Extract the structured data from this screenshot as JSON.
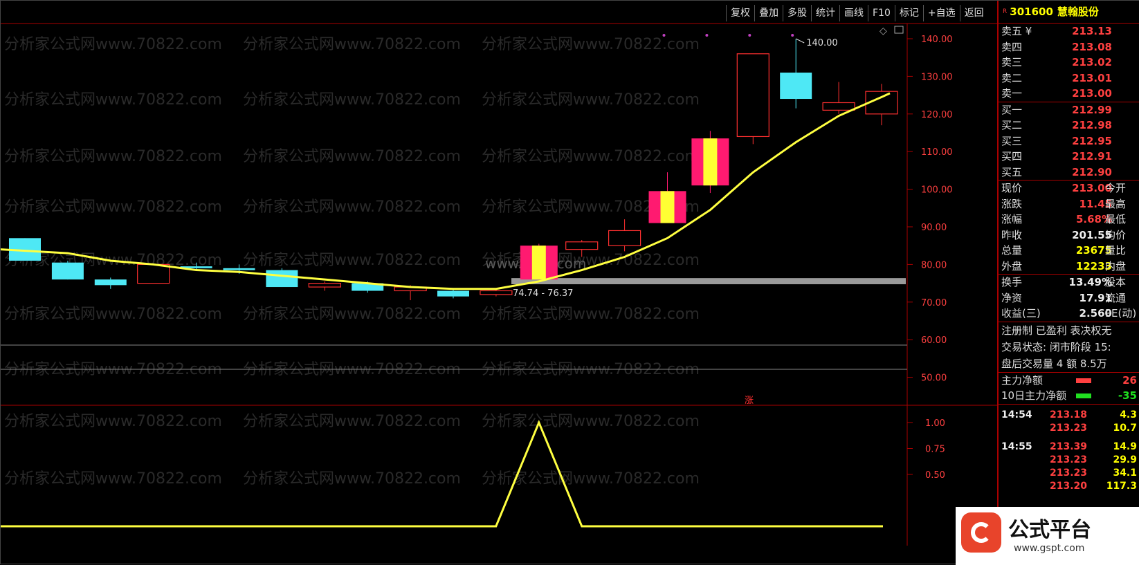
{
  "toolbar": {
    "buttons": [
      "复权",
      "叠加",
      "多股",
      "统计",
      "画线",
      "F10",
      "标记",
      "+自选",
      "返回"
    ]
  },
  "watermark": {
    "text": "分析家公式网www.70822.com",
    "center_text": "www.gspt.com"
  },
  "quote": {
    "marker": "R",
    "code": "301600",
    "name": "慧翰股份",
    "asks": [
      {
        "label": "卖五 ¥",
        "value": "213.13"
      },
      {
        "label": "卖四",
        "value": "213.08"
      },
      {
        "label": "卖三",
        "value": "213.02"
      },
      {
        "label": "卖二",
        "value": "213.01"
      },
      {
        "label": "卖一",
        "value": "213.00"
      }
    ],
    "bids": [
      {
        "label": "买一",
        "value": "212.99"
      },
      {
        "label": "买二",
        "value": "212.98"
      },
      {
        "label": "买三",
        "value": "212.95"
      },
      {
        "label": "买四",
        "value": "212.91"
      },
      {
        "label": "买五",
        "value": "212.90"
      }
    ],
    "stats": [
      {
        "label": "现价",
        "value": "213.00",
        "label2": "今开"
      },
      {
        "label": "涨跌",
        "value": "11.45",
        "label2": "最高"
      },
      {
        "label": "涨幅",
        "value": "5.68%",
        "label2": "最低"
      },
      {
        "label": "昨收",
        "value": "201.55",
        "label2": "均价"
      },
      {
        "label": "总量",
        "value": "23675",
        "label2": "量比"
      },
      {
        "label": "外盘",
        "value": "12233",
        "label2": "内盘"
      }
    ],
    "stats2": [
      {
        "label": "换手",
        "value": "13.49%",
        "label2": "股本"
      },
      {
        "label": "净资",
        "value": "17.91",
        "label2": "流通"
      },
      {
        "label": "收益(三)",
        "value": "2.560",
        "label2": "PE(动)"
      }
    ],
    "info_lines": [
      "注册制 已盈利 表决权无",
      "交易状态: 闭市阶段 15:",
      "盘后交易量 4 额 8.5万"
    ],
    "main_flow": [
      {
        "label": "主力净额",
        "value": "26"
      },
      {
        "label": "10日主力净额",
        "value": "-35"
      }
    ],
    "ticks": [
      {
        "time": "14:54",
        "price": "213.18",
        "vol": "4.3"
      },
      {
        "time": "",
        "price": "213.23",
        "vol": "10.7"
      },
      {
        "time": "14:55",
        "price": "213.39",
        "vol": "14.9"
      },
      {
        "time": "",
        "price": "213.23",
        "vol": "29.9"
      },
      {
        "time": "",
        "price": "213.23",
        "vol": "34.1"
      },
      {
        "time": "",
        "price": "213.20",
        "vol": "117.3"
      }
    ]
  },
  "logo": {
    "title": "公式平台",
    "url": "www.gspt.com"
  },
  "chart_data": [
    {
      "type": "candlestick",
      "y_ticks": [
        "140.00",
        "130.00",
        "120.00",
        "110.00",
        "100.00",
        "90.00",
        "80.00",
        "70.00",
        "60.00",
        "50.00"
      ],
      "ylim": [
        45,
        145
      ],
      "candles": [
        {
          "o": 81,
          "c": 87,
          "h": 87,
          "l": 81,
          "style": "cyan"
        },
        {
          "o": 80.5,
          "c": 76,
          "h": 81,
          "l": 76,
          "style": "cyan"
        },
        {
          "o": 76,
          "c": 74.5,
          "h": 76.5,
          "l": 73.5,
          "style": "cyan"
        },
        {
          "o": 75,
          "c": 80,
          "h": 80,
          "l": 75,
          "style": "red"
        },
        {
          "o": 79.5,
          "c": 79,
          "h": 80.5,
          "l": 78.5,
          "style": "cyan"
        },
        {
          "o": 79,
          "c": 78.5,
          "h": 80,
          "l": 77.5,
          "style": "cyan"
        },
        {
          "o": 78.5,
          "c": 74,
          "h": 79,
          "l": 74,
          "style": "cyan"
        },
        {
          "o": 74,
          "c": 75,
          "h": 75.5,
          "l": 73,
          "style": "red"
        },
        {
          "o": 75,
          "c": 73,
          "h": 75.5,
          "l": 72.5,
          "style": "cyan"
        },
        {
          "o": 73,
          "c": 74,
          "h": 74.5,
          "l": 70.5,
          "style": "red"
        },
        {
          "o": 73,
          "c": 71.5,
          "h": 73.5,
          "l": 71,
          "style": "cyan"
        },
        {
          "o": 72,
          "c": 73,
          "h": 73.5,
          "l": 71.5,
          "style": "red"
        },
        {
          "o": 76,
          "c": 85,
          "h": 85.5,
          "l": 76,
          "style": "magenta-yellow"
        },
        {
          "o": 84,
          "c": 86,
          "h": 86.5,
          "l": 82,
          "style": "red"
        },
        {
          "o": 85,
          "c": 89,
          "h": 92,
          "l": 83.5,
          "style": "red"
        },
        {
          "o": 91,
          "c": 99.5,
          "h": 104.5,
          "l": 91,
          "style": "magenta-yellow"
        },
        {
          "o": 101,
          "c": 113.5,
          "h": 115.5,
          "l": 99,
          "style": "magenta-yellow"
        },
        {
          "o": 114,
          "c": 136,
          "h": 136,
          "l": 112,
          "style": "red"
        },
        {
          "o": 131,
          "c": 124,
          "h": 140,
          "l": 121.5,
          "style": "cyan"
        },
        {
          "o": 121,
          "c": 123,
          "h": 128.5,
          "l": 120,
          "style": "red"
        },
        {
          "o": 120,
          "c": 126,
          "h": 128,
          "l": 117,
          "style": "red"
        }
      ],
      "ma_line": [
        84,
        83,
        81,
        80,
        78.5,
        78,
        77,
        76,
        75,
        74,
        73.5,
        73.5,
        75.5,
        78.5,
        82,
        87,
        94.5,
        104.5,
        112.5,
        119.5,
        124.5
      ],
      "band": {
        "low": 74.74,
        "high": 76.37,
        "label": "74.74 - 76.37"
      },
      "peak_label": "140.00",
      "up_marker": "涨"
    },
    {
      "type": "line",
      "y_ticks": [
        "1.00",
        "0.75",
        "0.50"
      ],
      "ylim": [
        -0.07,
        1.07
      ],
      "values": [
        0,
        0,
        0,
        0,
        0,
        0,
        0,
        0,
        0,
        0,
        0,
        0,
        1,
        0,
        0,
        0,
        0,
        0,
        0,
        0,
        0
      ]
    }
  ]
}
